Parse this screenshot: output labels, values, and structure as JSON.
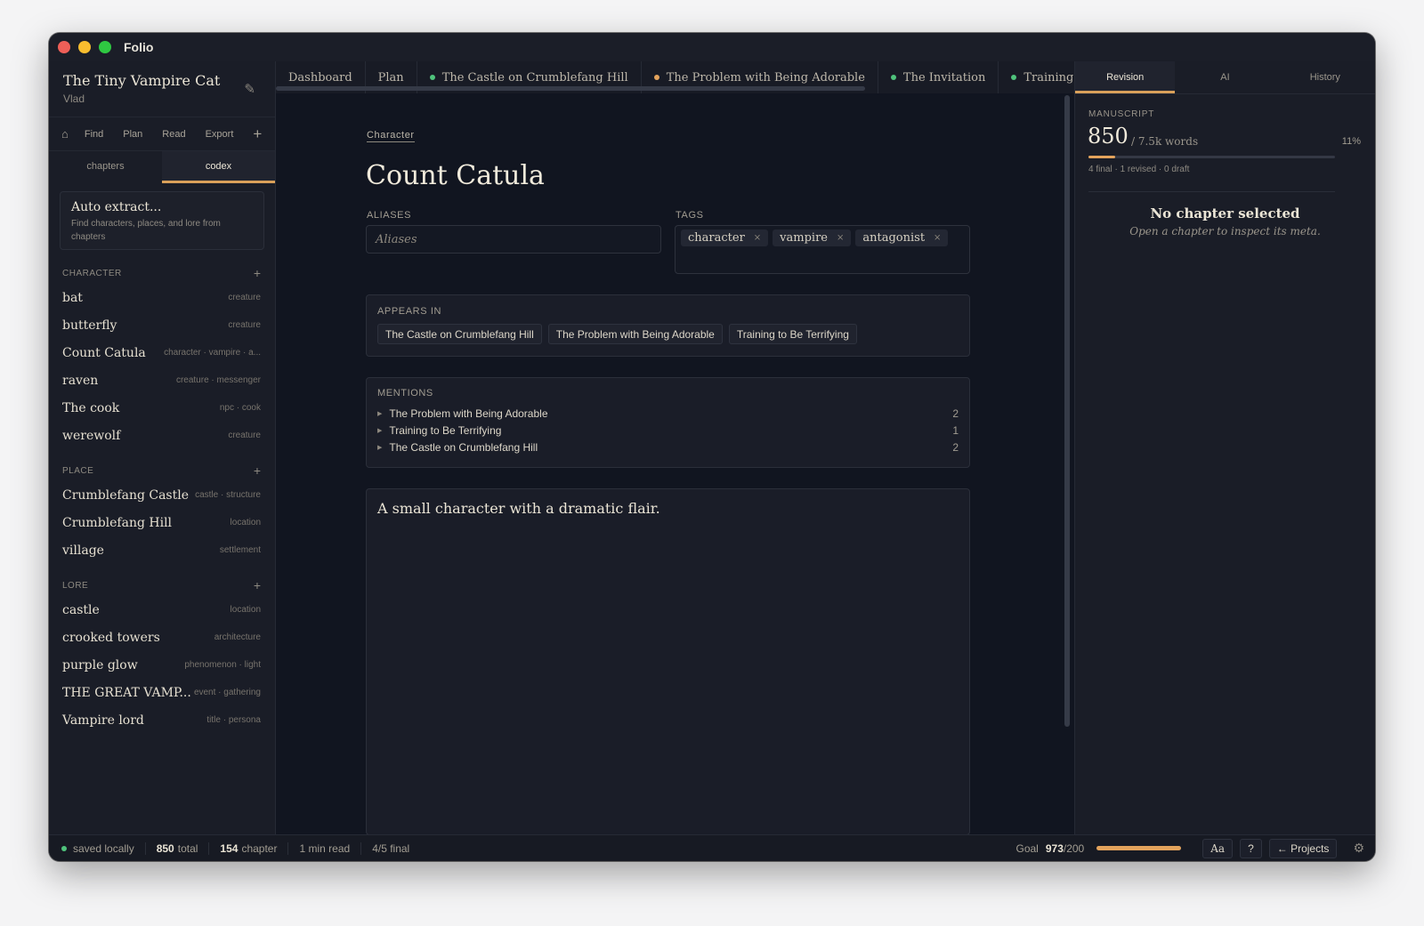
{
  "app": {
    "title": "Folio"
  },
  "project": {
    "title": "The Tiny Vampire Cat",
    "author": "Vlad"
  },
  "sidebar": {
    "nav": [
      {
        "label": "Find"
      },
      {
        "label": "Plan"
      },
      {
        "label": "Read"
      },
      {
        "label": "Export"
      }
    ],
    "tabs": [
      {
        "label": "chapters"
      },
      {
        "label": "codex"
      }
    ],
    "extract": {
      "title": "Auto extract...",
      "desc": "Find characters, places, and lore from chapters"
    },
    "sections": [
      {
        "label": "CHARACTER",
        "items": [
          {
            "name": "bat",
            "meta": "creature"
          },
          {
            "name": "butterfly",
            "meta": "creature"
          },
          {
            "name": "Count Catula",
            "meta": "character · vampire · a..."
          },
          {
            "name": "raven",
            "meta": "creature · messenger"
          },
          {
            "name": "The cook",
            "meta": "npc · cook"
          },
          {
            "name": "werewolf",
            "meta": "creature"
          }
        ]
      },
      {
        "label": "PLACE",
        "items": [
          {
            "name": "Crumblefang Castle",
            "meta": "castle · structure"
          },
          {
            "name": "Crumblefang Hill",
            "meta": "location"
          },
          {
            "name": "village",
            "meta": "settlement"
          }
        ]
      },
      {
        "label": "LORE",
        "items": [
          {
            "name": "castle",
            "meta": "location"
          },
          {
            "name": "crooked towers",
            "meta": "architecture"
          },
          {
            "name": "purple glow",
            "meta": "phenomenon · light"
          },
          {
            "name": "THE GREAT VAMP...",
            "meta": "event · gathering"
          },
          {
            "name": "Vampire lord",
            "meta": "title · persona"
          }
        ]
      }
    ]
  },
  "doc_tabs": [
    {
      "label": "Dashboard",
      "dot": ""
    },
    {
      "label": "Plan",
      "dot": ""
    },
    {
      "label": "The Castle on Crumblefang Hill",
      "dot": "#4fc37c"
    },
    {
      "label": "The Problem with Being Adorable",
      "dot": "#e3a35c"
    },
    {
      "label": "The Invitation",
      "dot": "#4fc37c"
    },
    {
      "label": "Training to Be Terrifying",
      "dot": "#4fc37c"
    }
  ],
  "entry": {
    "kind": "Character",
    "name": "Count Catula",
    "aliases_label": "ALIASES",
    "aliases_placeholder": "Aliases",
    "tags_label": "TAGS",
    "tags": [
      "character",
      "vampire",
      "antagonist"
    ],
    "appears_label": "APPEARS IN",
    "appears": [
      "The Castle on Crumblefang Hill",
      "The Problem with Being Adorable",
      "Training to Be Terrifying"
    ],
    "mentions_label": "MENTIONS",
    "mentions": [
      {
        "title": "The Problem with Being Adorable",
        "count": "2"
      },
      {
        "title": "Training to Be Terrifying",
        "count": "1"
      },
      {
        "title": "The Castle on Crumblefang Hill",
        "count": "2"
      }
    ],
    "notes": "A small character with a dramatic flair."
  },
  "right_panel": {
    "tabs": [
      {
        "label": "Revision"
      },
      {
        "label": "AI"
      },
      {
        "label": "History"
      }
    ],
    "manuscript_label": "MANUSCRIPT",
    "count": "850",
    "words": "/ 7.5k words",
    "percent": "11%",
    "progress": 0.11,
    "status": "4 final · 1 revised · 0 draft",
    "empty_title": "No chapter selected",
    "empty_sub": "Open a chapter to inspect its meta."
  },
  "statusbar": {
    "saved": "saved locally",
    "total_num": "850",
    "total_lbl": "total",
    "chapter_num": "154",
    "chapter_lbl": "chapter",
    "read": "1 min read",
    "final": "4/5 final",
    "goal_lbl": "Goal",
    "goal_num": "973",
    "goal_den": "/200",
    "goal_progress": 1.0,
    "font_btn": "Aa",
    "help_btn": "?",
    "projects_btn": "← Projects"
  },
  "colors": {
    "accent": "#e3a35c",
    "saved_dot": "#4fc37c"
  }
}
